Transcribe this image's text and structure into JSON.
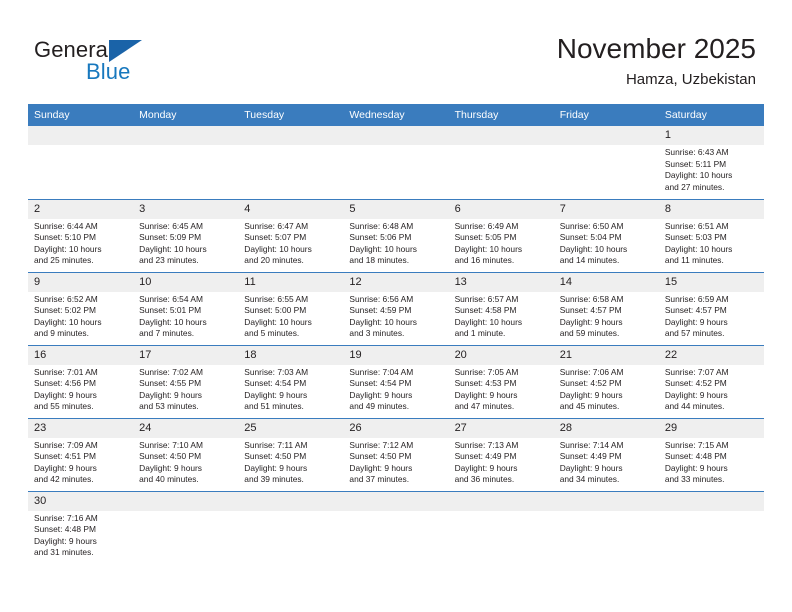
{
  "brand": {
    "name_part1": "General",
    "name_part2": "Blue",
    "logo_icon": "triangle-right-icon",
    "accent_color": "#1878be"
  },
  "header": {
    "title": "November 2025",
    "subtitle": "Hamza, Uzbekistan"
  },
  "theme": {
    "header_bg": "#3a7cbe",
    "daynum_bg": "#efefef",
    "text": "#231f20"
  },
  "weekday_headers": [
    "Sunday",
    "Monday",
    "Tuesday",
    "Wednesday",
    "Thursday",
    "Friday",
    "Saturday"
  ],
  "weeks": [
    [
      {
        "day": "",
        "sunrise": "",
        "sunset": "",
        "daylight1": "",
        "daylight2": ""
      },
      {
        "day": "",
        "sunrise": "",
        "sunset": "",
        "daylight1": "",
        "daylight2": ""
      },
      {
        "day": "",
        "sunrise": "",
        "sunset": "",
        "daylight1": "",
        "daylight2": ""
      },
      {
        "day": "",
        "sunrise": "",
        "sunset": "",
        "daylight1": "",
        "daylight2": ""
      },
      {
        "day": "",
        "sunrise": "",
        "sunset": "",
        "daylight1": "",
        "daylight2": ""
      },
      {
        "day": "",
        "sunrise": "",
        "sunset": "",
        "daylight1": "",
        "daylight2": ""
      },
      {
        "day": "1",
        "sunrise": "Sunrise: 6:43 AM",
        "sunset": "Sunset: 5:11 PM",
        "daylight1": "Daylight: 10 hours",
        "daylight2": "and 27 minutes."
      }
    ],
    [
      {
        "day": "2",
        "sunrise": "Sunrise: 6:44 AM",
        "sunset": "Sunset: 5:10 PM",
        "daylight1": "Daylight: 10 hours",
        "daylight2": "and 25 minutes."
      },
      {
        "day": "3",
        "sunrise": "Sunrise: 6:45 AM",
        "sunset": "Sunset: 5:09 PM",
        "daylight1": "Daylight: 10 hours",
        "daylight2": "and 23 minutes."
      },
      {
        "day": "4",
        "sunrise": "Sunrise: 6:47 AM",
        "sunset": "Sunset: 5:07 PM",
        "daylight1": "Daylight: 10 hours",
        "daylight2": "and 20 minutes."
      },
      {
        "day": "5",
        "sunrise": "Sunrise: 6:48 AM",
        "sunset": "Sunset: 5:06 PM",
        "daylight1": "Daylight: 10 hours",
        "daylight2": "and 18 minutes."
      },
      {
        "day": "6",
        "sunrise": "Sunrise: 6:49 AM",
        "sunset": "Sunset: 5:05 PM",
        "daylight1": "Daylight: 10 hours",
        "daylight2": "and 16 minutes."
      },
      {
        "day": "7",
        "sunrise": "Sunrise: 6:50 AM",
        "sunset": "Sunset: 5:04 PM",
        "daylight1": "Daylight: 10 hours",
        "daylight2": "and 14 minutes."
      },
      {
        "day": "8",
        "sunrise": "Sunrise: 6:51 AM",
        "sunset": "Sunset: 5:03 PM",
        "daylight1": "Daylight: 10 hours",
        "daylight2": "and 11 minutes."
      }
    ],
    [
      {
        "day": "9",
        "sunrise": "Sunrise: 6:52 AM",
        "sunset": "Sunset: 5:02 PM",
        "daylight1": "Daylight: 10 hours",
        "daylight2": "and 9 minutes."
      },
      {
        "day": "10",
        "sunrise": "Sunrise: 6:54 AM",
        "sunset": "Sunset: 5:01 PM",
        "daylight1": "Daylight: 10 hours",
        "daylight2": "and 7 minutes."
      },
      {
        "day": "11",
        "sunrise": "Sunrise: 6:55 AM",
        "sunset": "Sunset: 5:00 PM",
        "daylight1": "Daylight: 10 hours",
        "daylight2": "and 5 minutes."
      },
      {
        "day": "12",
        "sunrise": "Sunrise: 6:56 AM",
        "sunset": "Sunset: 4:59 PM",
        "daylight1": "Daylight: 10 hours",
        "daylight2": "and 3 minutes."
      },
      {
        "day": "13",
        "sunrise": "Sunrise: 6:57 AM",
        "sunset": "Sunset: 4:58 PM",
        "daylight1": "Daylight: 10 hours",
        "daylight2": "and 1 minute."
      },
      {
        "day": "14",
        "sunrise": "Sunrise: 6:58 AM",
        "sunset": "Sunset: 4:57 PM",
        "daylight1": "Daylight: 9 hours",
        "daylight2": "and 59 minutes."
      },
      {
        "day": "15",
        "sunrise": "Sunrise: 6:59 AM",
        "sunset": "Sunset: 4:57 PM",
        "daylight1": "Daylight: 9 hours",
        "daylight2": "and 57 minutes."
      }
    ],
    [
      {
        "day": "16",
        "sunrise": "Sunrise: 7:01 AM",
        "sunset": "Sunset: 4:56 PM",
        "daylight1": "Daylight: 9 hours",
        "daylight2": "and 55 minutes."
      },
      {
        "day": "17",
        "sunrise": "Sunrise: 7:02 AM",
        "sunset": "Sunset: 4:55 PM",
        "daylight1": "Daylight: 9 hours",
        "daylight2": "and 53 minutes."
      },
      {
        "day": "18",
        "sunrise": "Sunrise: 7:03 AM",
        "sunset": "Sunset: 4:54 PM",
        "daylight1": "Daylight: 9 hours",
        "daylight2": "and 51 minutes."
      },
      {
        "day": "19",
        "sunrise": "Sunrise: 7:04 AM",
        "sunset": "Sunset: 4:54 PM",
        "daylight1": "Daylight: 9 hours",
        "daylight2": "and 49 minutes."
      },
      {
        "day": "20",
        "sunrise": "Sunrise: 7:05 AM",
        "sunset": "Sunset: 4:53 PM",
        "daylight1": "Daylight: 9 hours",
        "daylight2": "and 47 minutes."
      },
      {
        "day": "21",
        "sunrise": "Sunrise: 7:06 AM",
        "sunset": "Sunset: 4:52 PM",
        "daylight1": "Daylight: 9 hours",
        "daylight2": "and 45 minutes."
      },
      {
        "day": "22",
        "sunrise": "Sunrise: 7:07 AM",
        "sunset": "Sunset: 4:52 PM",
        "daylight1": "Daylight: 9 hours",
        "daylight2": "and 44 minutes."
      }
    ],
    [
      {
        "day": "23",
        "sunrise": "Sunrise: 7:09 AM",
        "sunset": "Sunset: 4:51 PM",
        "daylight1": "Daylight: 9 hours",
        "daylight2": "and 42 minutes."
      },
      {
        "day": "24",
        "sunrise": "Sunrise: 7:10 AM",
        "sunset": "Sunset: 4:50 PM",
        "daylight1": "Daylight: 9 hours",
        "daylight2": "and 40 minutes."
      },
      {
        "day": "25",
        "sunrise": "Sunrise: 7:11 AM",
        "sunset": "Sunset: 4:50 PM",
        "daylight1": "Daylight: 9 hours",
        "daylight2": "and 39 minutes."
      },
      {
        "day": "26",
        "sunrise": "Sunrise: 7:12 AM",
        "sunset": "Sunset: 4:50 PM",
        "daylight1": "Daylight: 9 hours",
        "daylight2": "and 37 minutes."
      },
      {
        "day": "27",
        "sunrise": "Sunrise: 7:13 AM",
        "sunset": "Sunset: 4:49 PM",
        "daylight1": "Daylight: 9 hours",
        "daylight2": "and 36 minutes."
      },
      {
        "day": "28",
        "sunrise": "Sunrise: 7:14 AM",
        "sunset": "Sunset: 4:49 PM",
        "daylight1": "Daylight: 9 hours",
        "daylight2": "and 34 minutes."
      },
      {
        "day": "29",
        "sunrise": "Sunrise: 7:15 AM",
        "sunset": "Sunset: 4:48 PM",
        "daylight1": "Daylight: 9 hours",
        "daylight2": "and 33 minutes."
      }
    ],
    [
      {
        "day": "30",
        "sunrise": "Sunrise: 7:16 AM",
        "sunset": "Sunset: 4:48 PM",
        "daylight1": "Daylight: 9 hours",
        "daylight2": "and 31 minutes."
      },
      {
        "day": "",
        "sunrise": "",
        "sunset": "",
        "daylight1": "",
        "daylight2": ""
      },
      {
        "day": "",
        "sunrise": "",
        "sunset": "",
        "daylight1": "",
        "daylight2": ""
      },
      {
        "day": "",
        "sunrise": "",
        "sunset": "",
        "daylight1": "",
        "daylight2": ""
      },
      {
        "day": "",
        "sunrise": "",
        "sunset": "",
        "daylight1": "",
        "daylight2": ""
      },
      {
        "day": "",
        "sunrise": "",
        "sunset": "",
        "daylight1": "",
        "daylight2": ""
      },
      {
        "day": "",
        "sunrise": "",
        "sunset": "",
        "daylight1": "",
        "daylight2": ""
      }
    ]
  ]
}
